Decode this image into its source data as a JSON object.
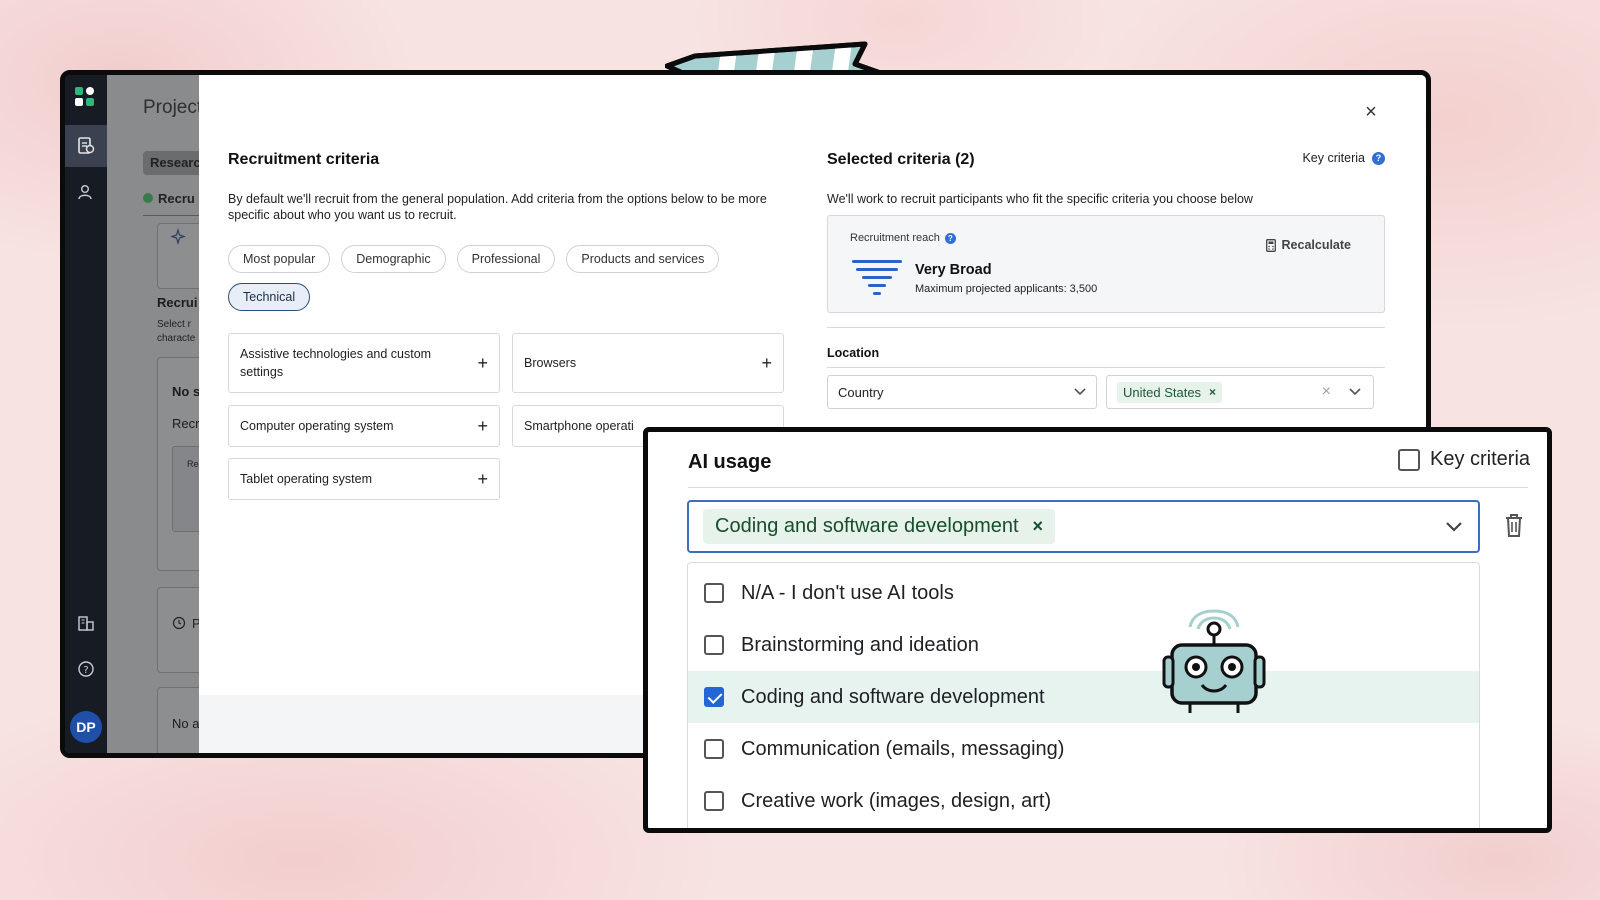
{
  "sidebar": {
    "avatar_initials": "DP",
    "icons": [
      "app-logo-icon",
      "document-icon",
      "users-icon",
      "building-icon",
      "help-icon"
    ]
  },
  "background_page": {
    "title": "Project",
    "chip": "Research",
    "tab": "Recru",
    "section_title": "Recrui",
    "section_desc_1": "Select r",
    "section_desc_2": "characte",
    "card_title": "No s",
    "card_sub": "Recr",
    "card_inner": "Re",
    "history_text": "P",
    "bottom_text": "No a"
  },
  "modal": {
    "close_label": "×",
    "left": {
      "title": "Recruitment criteria",
      "description": "By default we'll recruit from the general population. Add criteria from the options below to be more specific about who you want us to recruit.",
      "filters": [
        "Most popular",
        "Demographic",
        "Professional",
        "Products and services",
        "Technical"
      ],
      "active_filter": "Technical",
      "criteria": [
        "Assistive technologies and custom settings",
        "Browsers",
        "Computer operating system",
        "Smartphone operati",
        "Tablet operating system"
      ]
    },
    "right": {
      "title": "Selected criteria (2)",
      "key_criteria_label": "Key criteria",
      "subtitle": "We'll work to recruit participants who fit the specific criteria you choose below",
      "reach_label": "Recruitment reach",
      "recalculate_label": "Recalculate",
      "reach_value": "Very Broad",
      "reach_sub": "Maximum projected applicants: 3,500",
      "location_label": "Location",
      "location_field": "Country",
      "location_value": "United States"
    }
  },
  "zoom_panel": {
    "title": "AI usage",
    "key_criteria_label": "Key criteria",
    "selected_tag": "Coding and software development",
    "options": [
      {
        "label": "N/A - I don't use AI tools",
        "checked": false
      },
      {
        "label": "Brainstorming and ideation",
        "checked": false
      },
      {
        "label": "Coding and software development",
        "checked": true
      },
      {
        "label": "Communication (emails, messaging)",
        "checked": false
      },
      {
        "label": "Creative work (images, design, art)",
        "checked": false
      }
    ]
  },
  "colors": {
    "accent_blue": "#2466d6",
    "tag_green_bg": "#e6f2ea",
    "tag_green_text": "#184d2d",
    "sidebar": "#161b24",
    "background_pink": "#f7e3e2",
    "ribbon_teal": "#a6cfcf"
  }
}
